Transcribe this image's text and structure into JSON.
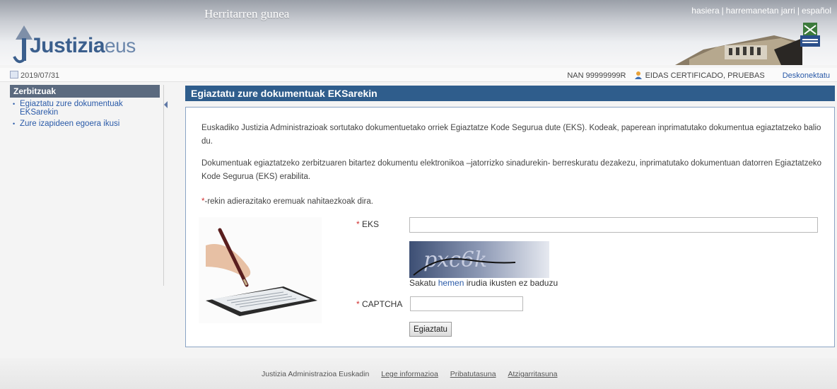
{
  "header": {
    "title": "Herritarren gunea",
    "links": [
      "hasiera",
      "harremanetan jarri",
      "español"
    ],
    "logo": {
      "brand": "Justizia",
      "suffix": "eus"
    }
  },
  "infobar": {
    "date": "2019/07/31",
    "nan": "NAN 99999999R",
    "user": "EIDAS CERTIFICADO, PRUEBAS",
    "logout": "Deskonektatu"
  },
  "sidebar": {
    "title": "Zerbitzuak",
    "items": [
      {
        "label": "Egiaztatu zure dokumentuak EKSarekin"
      },
      {
        "label": "Zure izapideen egoera ikusi"
      }
    ]
  },
  "main": {
    "title": "Egiaztatu zure dokumentuak EKSarekin",
    "para1": "Euskadiko Justizia Administrazioak sortutako dokumentuetako orriek Egiaztatze Kode Segurua dute (EKS). Kodeak, paperean inprimatutako dokumentua egiaztatzeko balio du.",
    "para2": "Dokumentuak egiaztatzeko zerbitzuaren bitartez dokumentu elektronikoa –jatorrizko sinadurekin- berreskuratu dezakezu, inprimatutako dokumentuan datorren Egiaztatzeko Kode Segurua (EKS) erabilita.",
    "required_note": "-rekin adierazitako eremuak nahitaezkoak dira.",
    "required_marker": "*",
    "eks_label": "EKS",
    "eks_value": "",
    "captcha_text": "pxc6k",
    "captcha_note_pre": "Sakatu ",
    "captcha_note_link": "hemen",
    "captcha_note_post": " irudia ikusten ez baduzu",
    "captcha_label": "CAPTCHA",
    "captcha_value": "",
    "submit_label": "Egiaztatu"
  },
  "footer": {
    "org": "Justizia Administrazioa Euskadin",
    "links": [
      "Lege informazioa",
      "Pribatutasuna",
      "Atzigarritasuna"
    ]
  },
  "colors": {
    "title_bar": "#2f5d8c",
    "sidebar_head": "#5b6a7f",
    "link": "#2a5aa8",
    "required": "#d03030"
  }
}
